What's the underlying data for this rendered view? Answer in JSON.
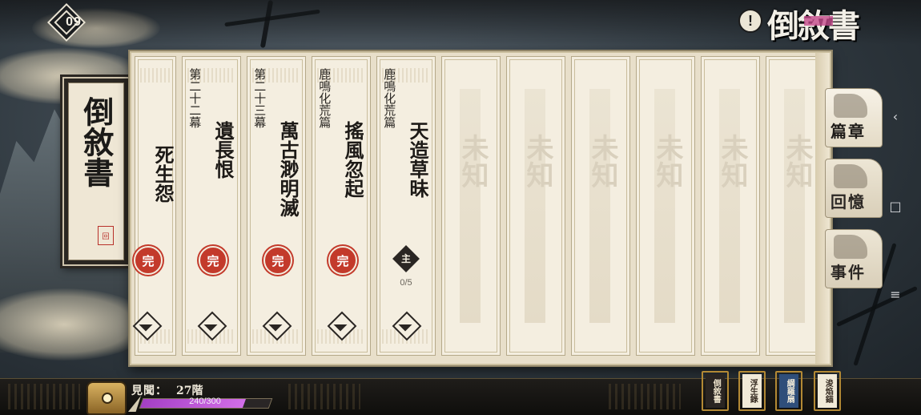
{
  "header": {
    "back_label": "09",
    "help_icon": "question-icon",
    "logo_text": "倒敘書"
  },
  "plaque": {
    "title": "倒敘書",
    "seal": "回"
  },
  "cards": [
    {
      "chapter": "",
      "name": "死生怨",
      "status": "完",
      "state": "done"
    },
    {
      "chapter": "第二十二幕",
      "name": "遺長恨",
      "status": "完",
      "state": "done"
    },
    {
      "chapter": "第二十三幕",
      "name": "萬古渺明滅",
      "status": "完",
      "state": "done"
    },
    {
      "chapter": "鹿鳴化荒篇",
      "name": "搖風忽起",
      "status": "完",
      "state": "done"
    },
    {
      "chapter": "鹿鳴化荒篇",
      "name": "天造草昧",
      "status": "主",
      "state": "current",
      "progress": "0/5"
    }
  ],
  "locked": {
    "mark": "未知",
    "count": 6
  },
  "side_tabs": [
    {
      "label": "篇章",
      "active": true
    },
    {
      "label": "回憶",
      "active": false
    },
    {
      "label": "事件",
      "active": false
    }
  ],
  "player": {
    "level_label": "見聞：",
    "level_value": "27階",
    "exp_text": "240/300",
    "exp_fraction": 0.8
  },
  "bottom_books": [
    {
      "label": "倒敘書",
      "bg": "#2a2522",
      "fg": "#e9dfc8"
    },
    {
      "label": "浮生錄",
      "bg": "#f1ead8",
      "fg": "#3a2f25"
    },
    {
      "label": "綱羅扇",
      "bg": "#2f4e7a",
      "fg": "#f1ead8"
    },
    {
      "label": "浚焰錨",
      "bg": "#f1ead8",
      "fg": "#3a2f25"
    }
  ],
  "colors": {
    "done_badge": "#c33a2b",
    "exp_fill": "#a43fc4",
    "panel": "#e8dfca"
  }
}
